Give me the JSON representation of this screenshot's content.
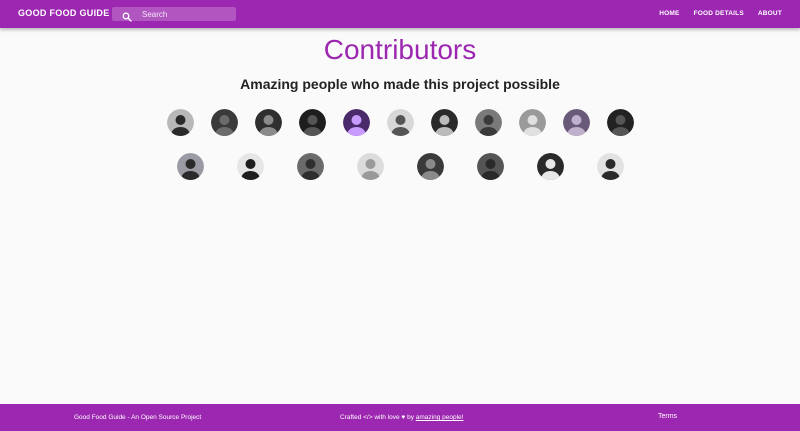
{
  "navbar": {
    "brand": "GOOD FOOD GUIDE",
    "search_icon": "search-icon",
    "search_placeholder": "Search",
    "links": [
      "HOME",
      "FOOD DETAILS",
      "ABOUT"
    ]
  },
  "main": {
    "title": "Contributors",
    "subtitle": "Amazing people who made this project possible"
  },
  "contributors": {
    "row1": [
      {
        "bg": "#b8b8b8",
        "fg": "#2a2a2a"
      },
      {
        "bg": "#3a3a3a",
        "fg": "#6b6b6b"
      },
      {
        "bg": "#2f2f2f",
        "fg": "#8a8a8a"
      },
      {
        "bg": "#1e1e1e",
        "fg": "#555555"
      },
      {
        "bg": "#4a2a6a",
        "fg": "#c79bff"
      },
      {
        "bg": "#d8d8d8",
        "fg": "#555555"
      },
      {
        "bg": "#2a2a2a",
        "fg": "#bbbbbb"
      },
      {
        "bg": "#7a7a7a",
        "fg": "#3a3a3a"
      },
      {
        "bg": "#9a9a9a",
        "fg": "#e0e0e0"
      },
      {
        "bg": "#6a5a7a",
        "fg": "#bfb0cc"
      },
      {
        "bg": "#222222",
        "fg": "#555555"
      }
    ],
    "row2": [
      {
        "bg": "#9a9aa5",
        "fg": "#2a2a2a"
      },
      {
        "bg": "#e6e6e6",
        "fg": "#1e1e1e"
      },
      {
        "bg": "#6a6a6a",
        "fg": "#2e2e2e"
      },
      {
        "bg": "#dcdcdc",
        "fg": "#9a9a9a"
      },
      {
        "bg": "#3a3a3a",
        "fg": "#8a8a8a"
      },
      {
        "bg": "#555555",
        "fg": "#2a2a2a"
      },
      {
        "bg": "#2a2a2a",
        "fg": "#e8e8e8"
      },
      {
        "bg": "#e2e2e2",
        "fg": "#2a2a2a"
      }
    ]
  },
  "footer": {
    "left": "Good Food Guide - An Open Source Project",
    "center_prefix": "Crafted </> with love ♥ by ",
    "center_link": "amazing people!",
    "right": "Terms"
  },
  "colors": {
    "primary": "#9c27b0",
    "background": "#fafafa"
  }
}
